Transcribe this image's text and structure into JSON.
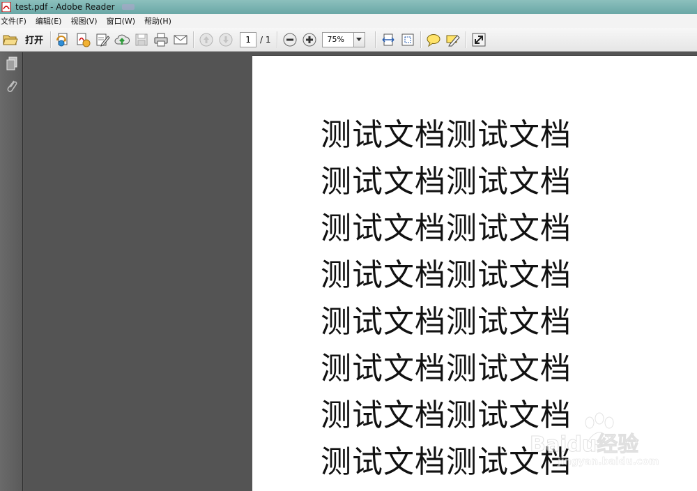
{
  "window": {
    "title": "test.pdf - Adobe Reader"
  },
  "menu": [
    {
      "label": "文件(F)"
    },
    {
      "label": "编辑(E)"
    },
    {
      "label": "视图(V)"
    },
    {
      "label": "窗口(W)"
    },
    {
      "label": "帮助(H)"
    }
  ],
  "toolbar": {
    "open_label": "打开",
    "page_current": "1",
    "page_total": "/ 1",
    "zoom": "75%"
  },
  "icons": {
    "open": "folder-open-icon",
    "create": "create-pdf-icon",
    "convert": "convert-pdf-icon",
    "edit": "edit-icon",
    "upload": "upload-icon",
    "save": "save-icon",
    "print": "print-icon",
    "email": "email-icon",
    "prev": "arrow-up-icon",
    "next": "arrow-down-icon",
    "zoom_out": "minus-icon",
    "zoom_in": "plus-icon",
    "fit_width": "fit-width-icon",
    "fit_page": "fit-page-icon",
    "comment": "comment-icon",
    "highlight": "highlight-icon",
    "fullscreen": "fullscreen-icon",
    "pages_panel": "pages-icon",
    "attachments": "paperclip-icon"
  },
  "document": {
    "lines": [
      "测试文档测试文档",
      "测试文档测试文档",
      "测试文档测试文档",
      "测试文档测试文档",
      "测试文档测试文档",
      "测试文档测试文档",
      "测试文档测试文档",
      "测试文档测试文档"
    ]
  },
  "watermark": {
    "brand": "Baidu经验",
    "url": "jingyan.baidu.com"
  },
  "colors": {
    "titlebar": "#6aa7a6",
    "viewer_bg": "#545454",
    "page_bg": "#ffffff"
  }
}
